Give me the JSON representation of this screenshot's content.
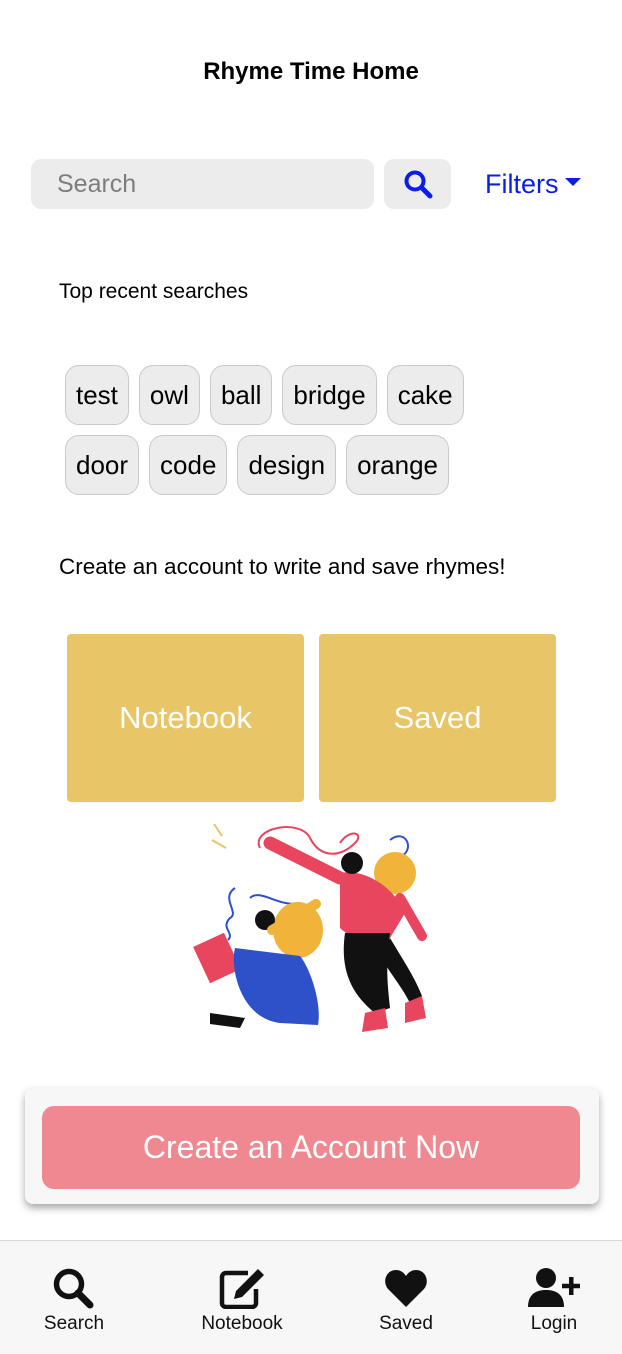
{
  "header": {
    "title": "Rhyme Time Home"
  },
  "search": {
    "placeholder": "Search",
    "filters_label": "Filters"
  },
  "recent": {
    "heading": "Top recent searches",
    "chips": [
      "test",
      "owl",
      "ball",
      "bridge",
      "cake",
      "door",
      "code",
      "design",
      "orange"
    ]
  },
  "account_prompt": "Create an account to write and save rhymes!",
  "tiles": {
    "notebook_label": "Notebook",
    "saved_label": "Saved"
  },
  "cta": {
    "label": "Create an Account Now"
  },
  "nav": {
    "items": [
      {
        "label": "Search",
        "icon": "search-icon"
      },
      {
        "label": "Notebook",
        "icon": "edit-icon"
      },
      {
        "label": "Saved",
        "icon": "heart-icon"
      },
      {
        "label": "Login",
        "icon": "user-plus-icon"
      }
    ]
  },
  "colors": {
    "accent_blue": "#0a1ee8",
    "tile_yellow": "#e8c566",
    "cta_pink": "#f08892",
    "chip_bg": "#ececec"
  }
}
